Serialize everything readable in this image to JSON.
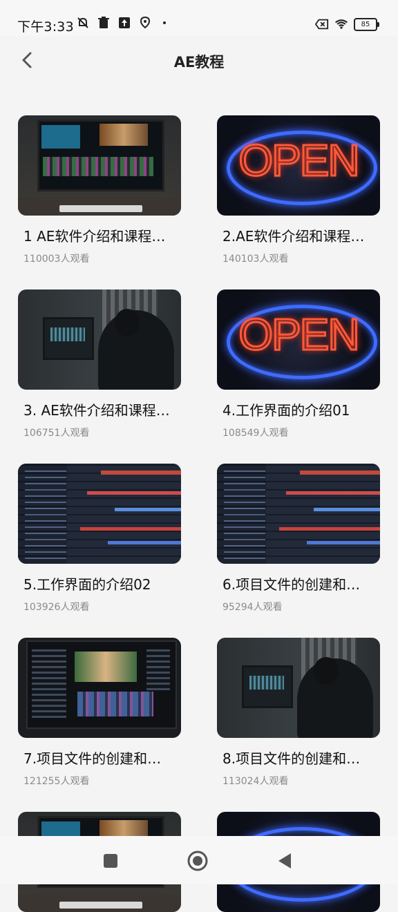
{
  "status_bar": {
    "time": "下午3:33",
    "battery": "85",
    "icons_left": [
      "mute-icon",
      "trash-icon",
      "upload-icon",
      "location-icon"
    ],
    "icons_right": [
      "sim-off-icon",
      "wifi-icon",
      "battery-icon"
    ]
  },
  "header": {
    "title": "AE教程",
    "back_icon": "chevron-left-icon"
  },
  "videos": [
    {
      "title": "1 AE软件介绍和课程…",
      "views": "110003人观看",
      "thumb": "monitor"
    },
    {
      "title": "2.AE软件介绍和课程…",
      "views": "140103人观看",
      "thumb": "open-sign"
    },
    {
      "title": "3. AE软件介绍和课程…",
      "views": "106751人观看",
      "thumb": "person-editing"
    },
    {
      "title": "4.工作界面的介绍01",
      "views": "108549人观看",
      "thumb": "open-sign"
    },
    {
      "title": "5.工作界面的介绍02",
      "views": "103926人观看",
      "thumb": "code-screen"
    },
    {
      "title": "6.项目文件的创建和…",
      "views": "95294人观看",
      "thumb": "code-screen"
    },
    {
      "title": "7.项目文件的创建和…",
      "views": "121255人观看",
      "thumb": "video-editor"
    },
    {
      "title": "8.项目文件的创建和…",
      "views": "113024人观看",
      "thumb": "person-editing"
    },
    {
      "title": "",
      "views": "",
      "thumb": "monitor"
    },
    {
      "title": "",
      "views": "",
      "thumb": "open-sign"
    }
  ],
  "nav_bar": {
    "items": [
      "recents-square-icon",
      "home-circle-icon",
      "back-triangle-icon"
    ]
  },
  "colors": {
    "background": "#f4f4f4",
    "title": "#222222",
    "views": "#8a8a8a"
  }
}
